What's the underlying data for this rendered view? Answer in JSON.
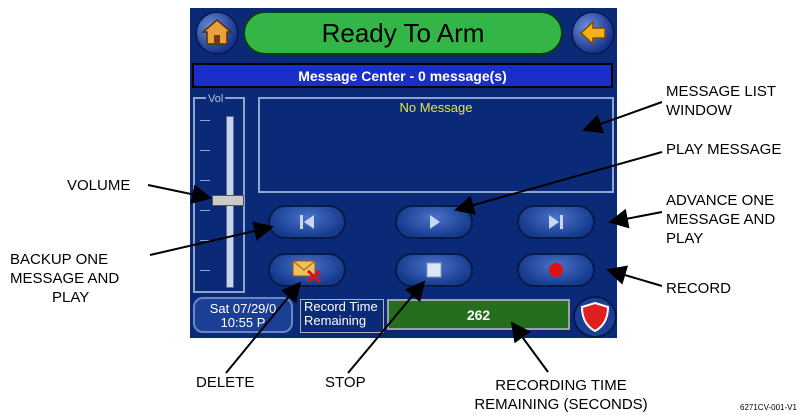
{
  "device": {
    "status": "Ready To Arm",
    "message_center": "Message Center - 0 message(s)",
    "volume_label": "Vol",
    "list_text": "No Message",
    "date_line1": "Sat 07/29/0",
    "date_line2": "10:55 P",
    "record_label_line1": "Record Time",
    "record_label_line2": "Remaining",
    "record_value": "262"
  },
  "callouts": {
    "volume": "VOLUME",
    "backup": [
      "BACKUP ONE",
      "MESSAGE AND",
      "PLAY"
    ],
    "delete": "DELETE",
    "stop": "STOP",
    "recording_time": [
      "RECORDING TIME",
      "REMAINING (SECONDS)"
    ],
    "message_list": [
      "MESSAGE LIST",
      "WINDOW"
    ],
    "play": "PLAY MESSAGE",
    "advance": [
      "ADVANCE ONE",
      "MESSAGE AND",
      "PLAY"
    ],
    "record": "RECORD"
  },
  "figure_id": "6271CV-001-V1",
  "colors": {
    "panel": "#0a2a78",
    "status_green": "#33b548",
    "header_blue": "#1a2ec8",
    "record_red": "#e01010",
    "list_text_yellow": "#e6e64a"
  },
  "icons": [
    "house-icon",
    "back-arrow-icon",
    "skip-back-icon",
    "play-icon",
    "skip-forward-icon",
    "delete-envelope-icon",
    "stop-icon",
    "record-icon",
    "shield-icon"
  ]
}
